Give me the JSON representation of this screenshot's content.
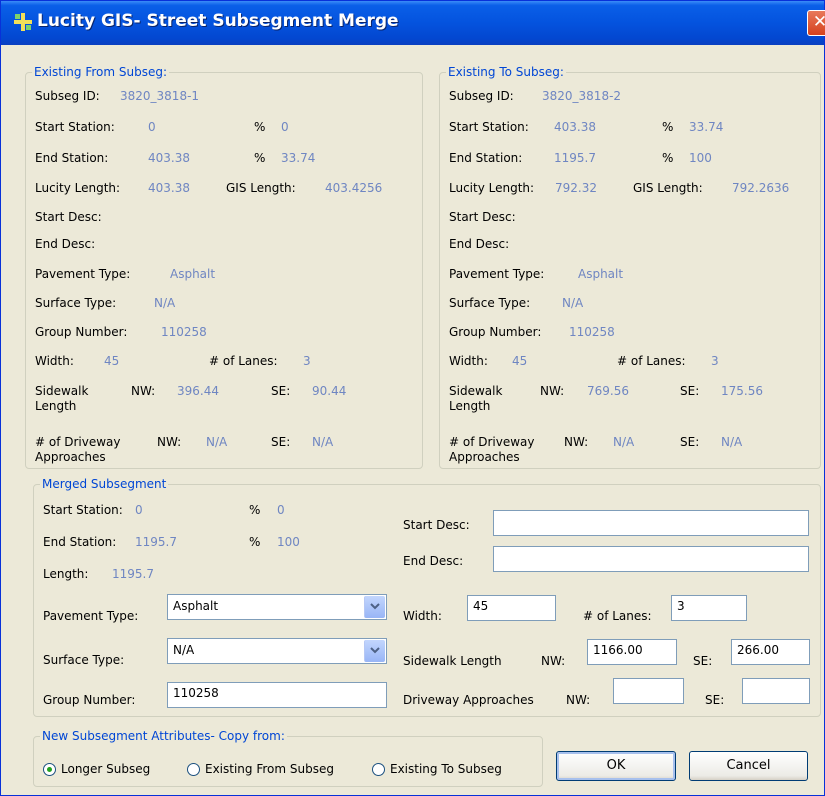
{
  "window": {
    "title": "Lucity GIS- Street Subsegment Merge",
    "close_glyph": "✕"
  },
  "from": {
    "legend": "Existing From Subseg:",
    "subseg_id_label": "Subseg ID:",
    "subseg_id": "3820_3818-1",
    "start_station_label": "Start Station:",
    "start_station": "0",
    "pct_label_1": "%",
    "start_pct": "0",
    "end_station_label": "End Station:",
    "end_station": "403.38",
    "pct_label_2": "%",
    "end_pct": "33.74",
    "lucity_length_label": "Lucity Length:",
    "lucity_length": "403.38",
    "gis_length_label": "GIS Length:",
    "gis_length": "403.4256",
    "start_desc_label": "Start Desc:",
    "end_desc_label": "End Desc:",
    "pavement_label": "Pavement Type:",
    "pavement": "Asphalt",
    "surface_label": "Surface Type:",
    "surface": "N/A",
    "group_label": "Group Number:",
    "group": "110258",
    "width_label": "Width:",
    "width": "45",
    "lanes_label": "# of Lanes:",
    "lanes": "3",
    "sidewalk_label_1": "Sidewalk",
    "sidewalk_label_2": "Length",
    "nw_label": "NW:",
    "sidewalk_nw": "396.44",
    "se_label": "SE:",
    "sidewalk_se": "90.44",
    "driveway_label_1": "# of Driveway",
    "driveway_label_2": "Approaches",
    "nw_label_2": "NW:",
    "driveway_nw": "N/A",
    "se_label_2": "SE:",
    "driveway_se": "N/A"
  },
  "to": {
    "legend": "Existing To Subseg:",
    "subseg_id_label": "Subseg ID:",
    "subseg_id": "3820_3818-2",
    "start_station_label": "Start Station:",
    "start_station": "403.38",
    "pct_label_1": "%",
    "start_pct": "33.74",
    "end_station_label": "End Station:",
    "end_station": "1195.7",
    "pct_label_2": "%",
    "end_pct": "100",
    "lucity_length_label": "Lucity Length:",
    "lucity_length": "792.32",
    "gis_length_label": "GIS Length:",
    "gis_length": "792.2636",
    "start_desc_label": "Start Desc:",
    "end_desc_label": "End Desc:",
    "pavement_label": "Pavement Type:",
    "pavement": "Asphalt",
    "surface_label": "Surface Type:",
    "surface": "N/A",
    "group_label": "Group Number:",
    "group": "110258",
    "width_label": "Width:",
    "width": "45",
    "lanes_label": "# of Lanes:",
    "lanes": "3",
    "sidewalk_label_1": "Sidewalk",
    "sidewalk_label_2": "Length",
    "nw_label": "NW:",
    "sidewalk_nw": "769.56",
    "se_label": "SE:",
    "sidewalk_se": "175.56",
    "driveway_label_1": "# of Driveway",
    "driveway_label_2": "Approaches",
    "nw_label_2": "NW:",
    "driveway_nw": "N/A",
    "se_label_2": "SE:",
    "driveway_se": "N/A"
  },
  "merged": {
    "legend": "Merged Subsegment",
    "start_station_label": "Start Station:",
    "start_station": "0",
    "pct_label_1": "%",
    "start_pct": "0",
    "end_station_label": "End Station:",
    "end_station": "1195.7",
    "pct_label_2": "%",
    "end_pct": "100",
    "length_label": "Length:",
    "length": "1195.7",
    "start_desc_label": "Start Desc:",
    "start_desc": "",
    "end_desc_label": "End Desc:",
    "end_desc": "",
    "pavement_label": "Pavement Type:",
    "pavement": "Asphalt",
    "surface_label": "Surface Type:",
    "surface": "N/A",
    "group_label": "Group Number:",
    "group": "110258",
    "width_label": "Width:",
    "width": "45",
    "lanes_label": "# of Lanes:",
    "lanes": "3",
    "sidewalk_label": "Sidewalk Length",
    "nw_label": "NW:",
    "sidewalk_nw": "1166.00",
    "se_label": "SE:",
    "sidewalk_se": "266.00",
    "driveway_label": "Driveway Approaches",
    "nw_label_2": "NW:",
    "driveway_nw": "",
    "se_label_2": "SE:",
    "driveway_se": ""
  },
  "copy_from": {
    "legend": "New Subsegment Attributes- Copy from:",
    "options": [
      "Longer Subseg",
      "Existing From Subseg",
      "Existing To Subseg"
    ],
    "selected": "Longer Subseg"
  },
  "buttons": {
    "ok": "OK",
    "cancel": "Cancel"
  },
  "colors": {
    "title_bar": "#0453de",
    "value_text": "#6f86c2",
    "legend_text": "#0046d5",
    "dialog_bg": "#ece9d8"
  }
}
